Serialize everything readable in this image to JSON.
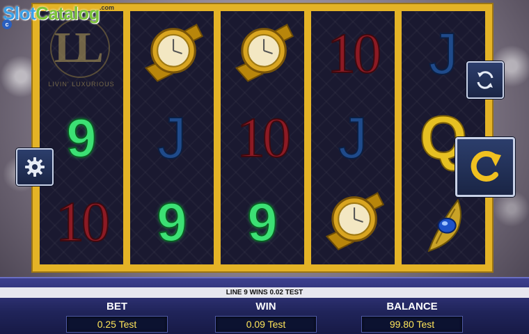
{
  "logo": {
    "slot": "Slot",
    "catalog": "Catalog",
    "com": ".com",
    "badge": "c"
  },
  "game": {
    "logo_text": "LL",
    "logo_subtitle": "LIVIN' LUXURIOUS"
  },
  "reels": [
    {
      "symbols": [
        "logo",
        "9",
        "10"
      ]
    },
    {
      "symbols": [
        "watch",
        "J",
        "9"
      ]
    },
    {
      "symbols": [
        "watch",
        "10",
        "9"
      ]
    },
    {
      "symbols": [
        "10",
        "J",
        "watch"
      ]
    },
    {
      "symbols": [
        "J",
        "Q",
        "peacock-brooch"
      ]
    }
  ],
  "buttons": {
    "settings_icon": "gear-icon",
    "autoplay_icon": "refresh-icon",
    "spin_icon": "spin-icon"
  },
  "status": {
    "message": "LINE 9 WINS 0.02 TEST"
  },
  "footer": {
    "bet_label": "BET",
    "bet_value": "0.25 Test",
    "win_label": "WIN",
    "win_value": "0.09 Test",
    "balance_label": "BALANCE",
    "balance_value": "99.80 Test"
  },
  "colors": {
    "frame_gold": "#e4b326",
    "footer_blue": "#20245a",
    "value_yellow": "#ffe55a"
  }
}
